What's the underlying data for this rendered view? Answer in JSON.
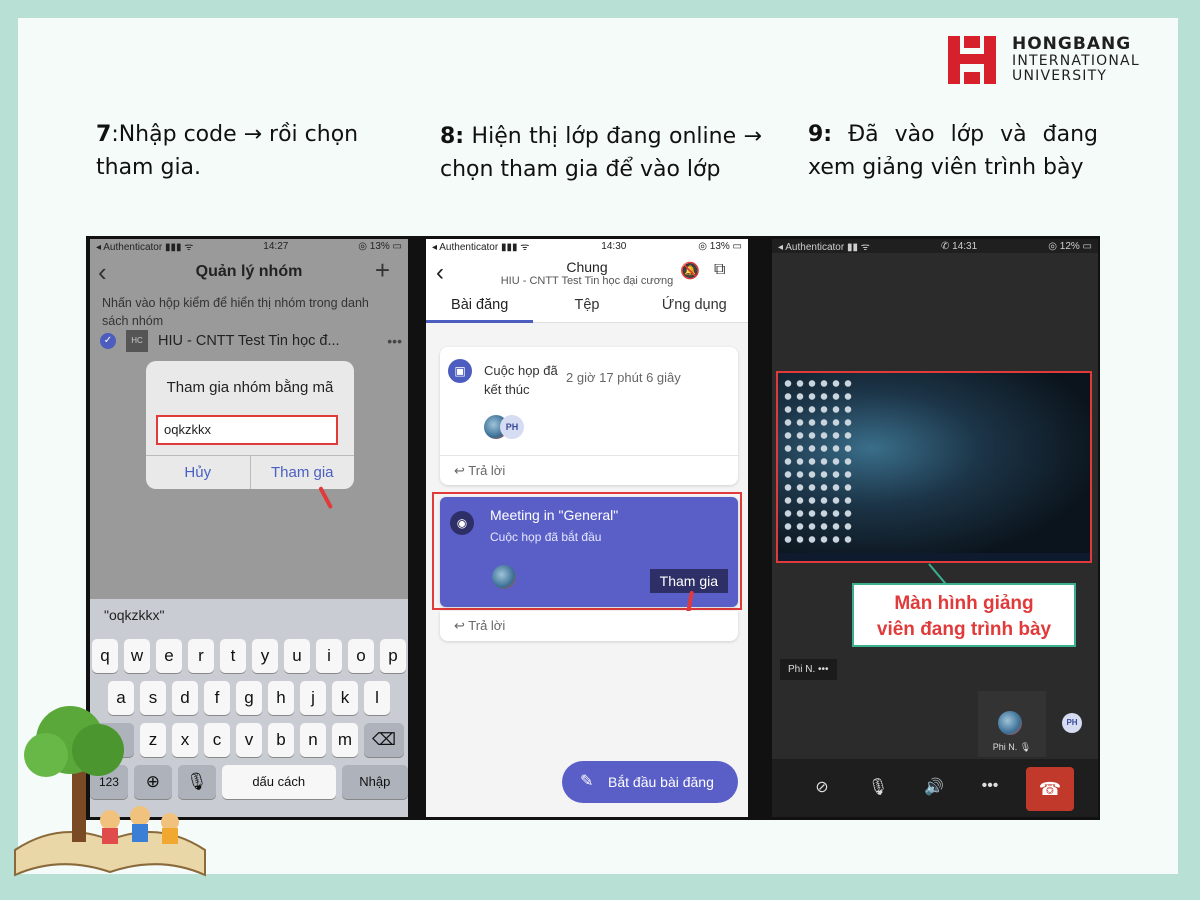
{
  "logo": {
    "line1": "HONGBANG",
    "line2": "INTERNATIONAL",
    "line3": "UNIVERSITY"
  },
  "captions": {
    "step7": {
      "num": "7",
      "text": ":Nhập code → rồi chọn tham gia."
    },
    "step8": {
      "num": "8:",
      "text": " Hiện thị lớp đang online → chọn tham gia để vào lớp"
    },
    "step9": {
      "num": "9:",
      "text": " Đã vào lớp và đang xem giảng viên trình bày"
    }
  },
  "panel7": {
    "status": {
      "left": "◂ Authenticator ▮▮▮ ᯤ",
      "time": "14:27",
      "right": "◎ 13% ▭"
    },
    "title": "Quản lý nhóm",
    "hint": "Nhấn vào hộp kiểm để hiển thị nhóm trong danh sách nhóm",
    "group_badge": "HC",
    "group_name": "HIU - CNTT Test Tin học đ...",
    "dialog_title": "Tham gia nhóm bằng mã",
    "code_value": "oqkzkkx",
    "cancel": "Hủy",
    "join": "Tham gia",
    "suggestion": "\"oqkzkkx\"",
    "keys_row1": [
      "q",
      "w",
      "e",
      "r",
      "t",
      "y",
      "u",
      "i",
      "o",
      "p"
    ],
    "keys_row2": [
      "a",
      "s",
      "d",
      "f",
      "g",
      "h",
      "j",
      "k",
      "l"
    ],
    "keys_row3": [
      "z",
      "x",
      "c",
      "v",
      "b",
      "n",
      "m"
    ],
    "key_123": "123",
    "key_space": "dấu cách",
    "key_enter": "Nhập"
  },
  "panel8": {
    "status": {
      "left": "◂ Authenticator ▮▮▮ ᯤ",
      "time": "14:30",
      "right": "◎ 13% ▭"
    },
    "channel": "Chung",
    "team": "HIU - CNTT Test Tin học đại cương",
    "tabs": [
      "Bài đăng",
      "Tệp",
      "Ứng dụng"
    ],
    "post1_title": "Cuộc họp đã kết thúc",
    "post1_duration": "2 giờ 17 phút 6 giây",
    "avatar_initials": "PH",
    "reply": "Trả lời",
    "meeting_title": "Meeting in \"General\"",
    "meeting_sub": "Cuộc họp đã bắt đầu",
    "meeting_join": "Tham gia",
    "new_post": "Bắt đầu bài đăng"
  },
  "panel9": {
    "status": {
      "left": "◂ Authenticator ▮▮ ᯤ",
      "time": "✆ 14:31",
      "right": "◎ 12% ▭"
    },
    "label_line1": "Màn hình giảng",
    "label_line2": "viên đang trình bày",
    "name_chip": "Phi N.  •••",
    "tile_name": "Phi N. 🎙",
    "ph_initials": "PH"
  },
  "colors": {
    "accent": "#5a5fc8",
    "highlight": "#e03a3a",
    "teal": "#3bb08f",
    "logo_red": "#d6202b"
  }
}
